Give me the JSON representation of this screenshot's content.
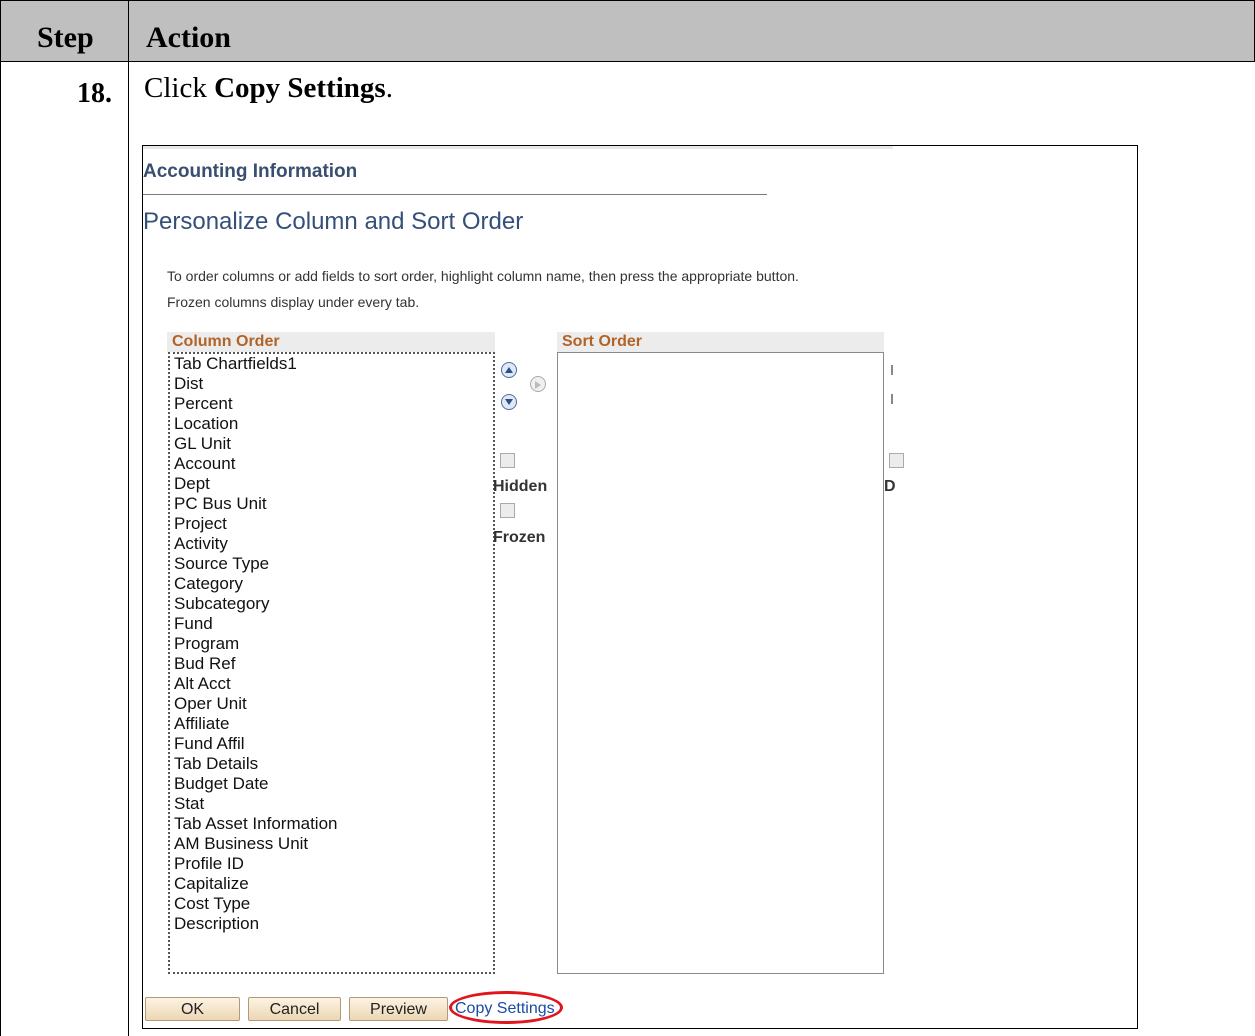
{
  "table": {
    "header_step": "Step",
    "header_action": "Action",
    "step_number": "18.",
    "instruction_prefix": "Click ",
    "instruction_bold": "Copy Settings",
    "instruction_suffix": "."
  },
  "page": {
    "title": "Accounting Information",
    "section_title": "Personalize Column and Sort Order",
    "instructions_line1": "To order columns or add fields to sort order, highlight column name, then press the appropriate button.",
    "instructions_line2": "Frozen columns display under every tab."
  },
  "column_order": {
    "header": "Column Order",
    "items": [
      "Tab Chartfields1",
      "Dist",
      "Percent",
      "Location",
      "GL Unit",
      "Account",
      "Dept",
      "PC Bus Unit",
      "Project",
      "Activity",
      "Source Type",
      "Category",
      "Subcategory",
      "Fund",
      "Program",
      "Bud Ref",
      "Alt Acct",
      "Oper Unit",
      "Affiliate",
      "Fund Affil",
      "Tab Details",
      "Budget Date",
      "Stat",
      "Tab Asset Information",
      "AM Business Unit",
      "Profile ID",
      "Capitalize",
      "Cost Type",
      "Description"
    ]
  },
  "sort_order": {
    "header": "Sort Order"
  },
  "options": {
    "hidden_label": "Hidden",
    "frozen_label": "Frozen",
    "right_label": "D"
  },
  "buttons": {
    "ok": "OK",
    "cancel": "Cancel",
    "preview": "Preview",
    "copy_settings": "Copy Settings"
  },
  "colors": {
    "header_bg": "#bfbfbf",
    "column_header_text": "#b26329",
    "link": "#1a4aa8",
    "highlight": "#e0161c"
  }
}
